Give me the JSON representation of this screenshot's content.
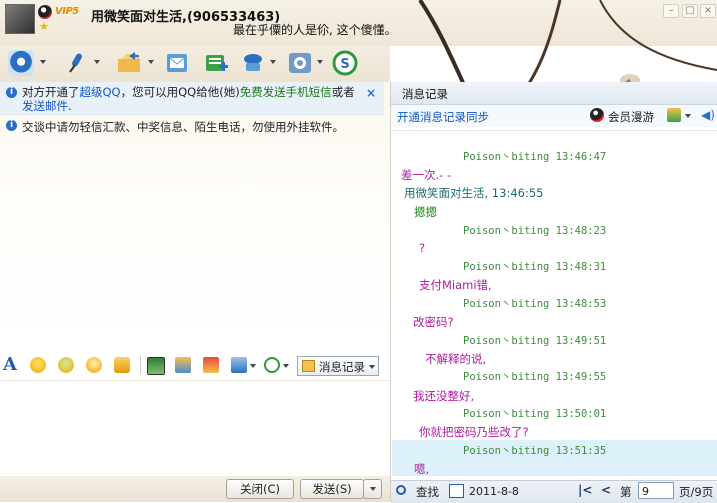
{
  "header": {
    "contact_name": "用微笑面对生活,(906533463)",
    "vip_badge": "VIP5",
    "signature": "最在乎僳的人是伱, 这个傻懂。"
  },
  "notices": {
    "n1_a": "对方开通了",
    "n1_link1": "超级QQ",
    "n1_b": "，您可以用QQ给他(她)",
    "n1_link2": "免费发送手机短信",
    "n1_c": "或者",
    "n1_link3": "发送邮件",
    "n1_d": ".",
    "close_symbol": "×",
    "n2": "交谈中请勿轻信汇款、中奖信息、陌生电话，勿使用外挂软件。"
  },
  "format_bar": {
    "msg_log_label": "消息记录"
  },
  "buttons": {
    "close": "关闭(C)",
    "send": "发送(S)"
  },
  "history": {
    "title": "消息记录",
    "sync_link": "开通消息记录同步",
    "roaming": "会员漫游",
    "messages": [
      {
        "header": "Poison丶biting 13:46:47",
        "body": "差一次.- -"
      },
      {
        "header": "用微笑面对生活, 13:46:55",
        "body": "摁摁"
      },
      {
        "header": "Poison丶biting 13:48:23",
        "body": "?"
      },
      {
        "header": "Poison丶biting 13:48:31",
        "body": "支付Miami错,"
      },
      {
        "header": "Poison丶biting 13:48:53",
        "body": "改密码?"
      },
      {
        "header": "Poison丶biting 13:49:51",
        "body": "不解释的说,"
      },
      {
        "header": "Poison丶biting 13:49:55",
        "body": "我还没整好,"
      },
      {
        "header": "Poison丶biting 13:50:01",
        "body": "你就把密码乃些改了?"
      },
      {
        "header": "Poison丶biting 13:51:35",
        "body": "嗯,"
      }
    ],
    "footer": {
      "search": "查找",
      "date": "2011-8-8",
      "page_prefix": "第",
      "page_value": "9",
      "page_suffix": "页/9页"
    }
  },
  "colors": {
    "accent_blue": "#1259c3",
    "header_green": "#3d8c3d",
    "body_purple": "#b01aa0",
    "self_green": "#1a7a1a"
  }
}
